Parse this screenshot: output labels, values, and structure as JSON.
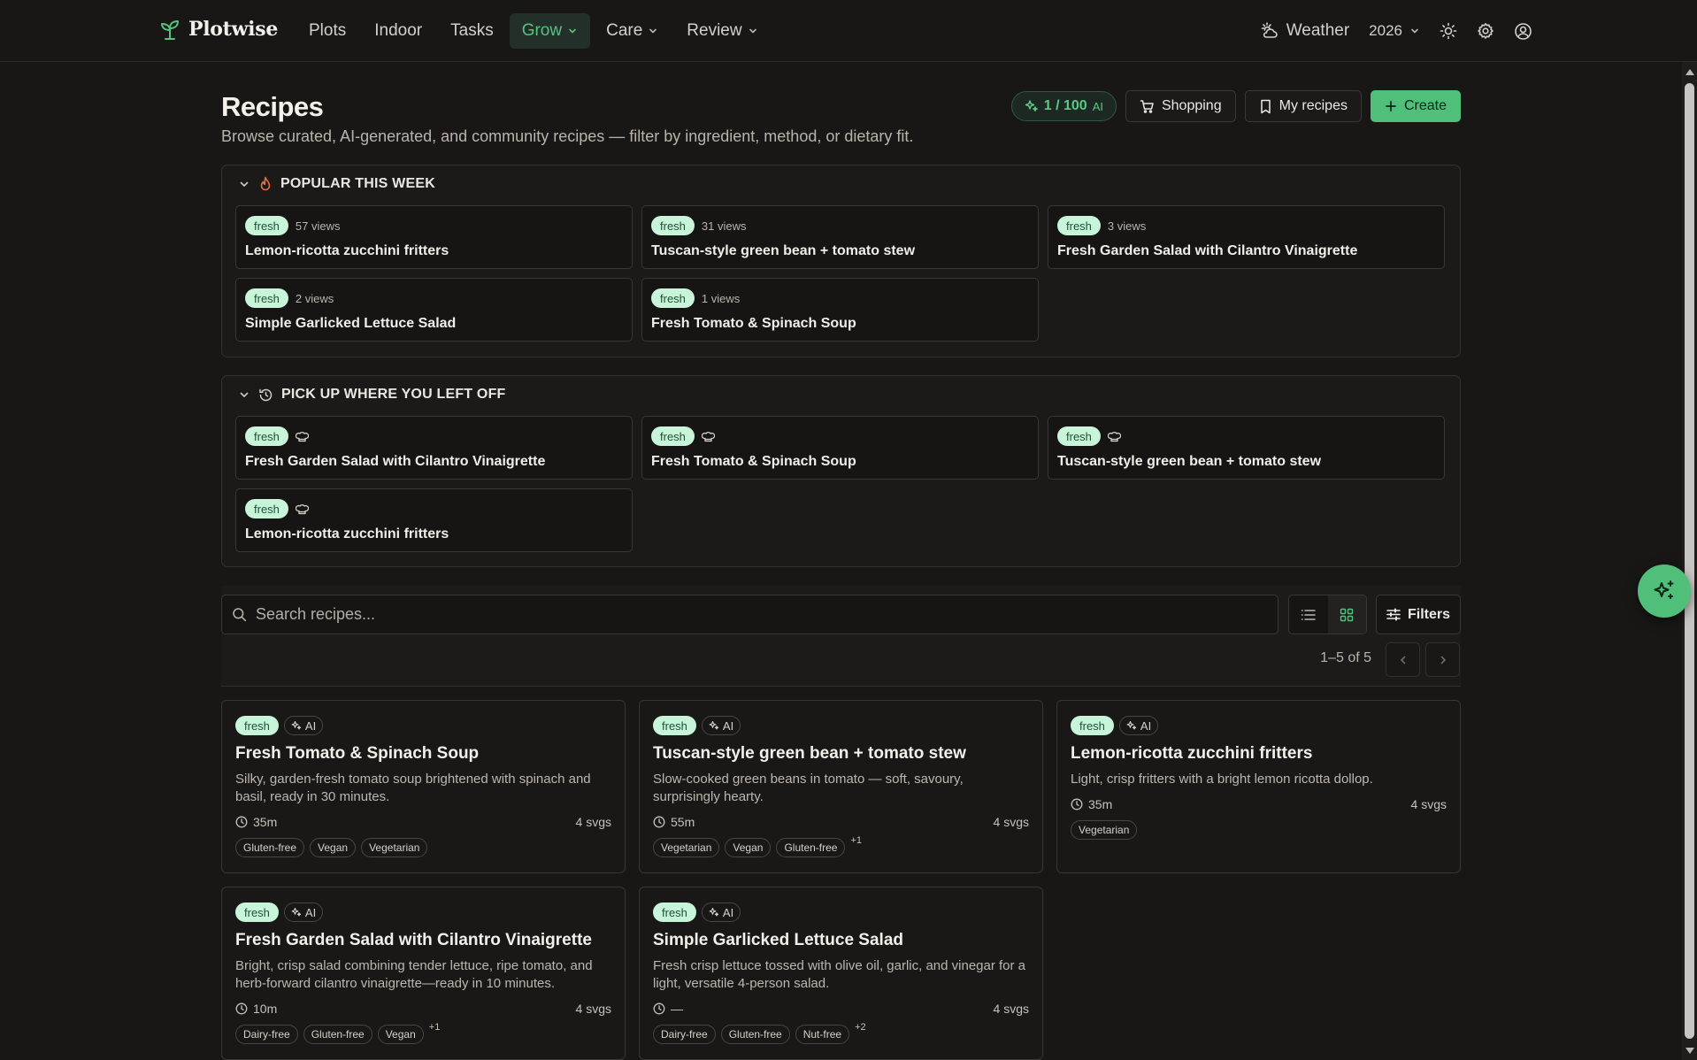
{
  "nav": {
    "brand": "Plotwise",
    "links": [
      {
        "label": "Plots"
      },
      {
        "label": "Indoor"
      },
      {
        "label": "Tasks"
      },
      {
        "label": "Grow"
      },
      {
        "label": "Care"
      },
      {
        "label": "Review"
      }
    ],
    "weather": "Weather",
    "year": "2026"
  },
  "header": {
    "title": "Recipes",
    "subtitle": "Browse curated, AI-generated, and community recipes — filter by ingredient, method, or dietary fit.",
    "ai_quota": "1 / 100",
    "ai_suffix": "AI",
    "shopping": "Shopping",
    "my_recipes": "My recipes",
    "create": "Create"
  },
  "popular": {
    "title": "POPULAR THIS WEEK",
    "items": [
      {
        "badge": "fresh",
        "views": "57 views",
        "title": "Lemon-ricotta zucchini fritters"
      },
      {
        "badge": "fresh",
        "views": "31 views",
        "title": "Tuscan-style green bean + tomato stew"
      },
      {
        "badge": "fresh",
        "views": "3 views",
        "title": "Fresh Garden Salad with Cilantro Vinaigrette"
      },
      {
        "badge": "fresh",
        "views": "2 views",
        "title": "Simple Garlicked Lettuce Salad"
      },
      {
        "badge": "fresh",
        "views": "1 views",
        "title": "Fresh Tomato & Spinach Soup"
      }
    ]
  },
  "recent": {
    "title": "PICK UP WHERE YOU LEFT OFF",
    "items": [
      {
        "badge": "fresh",
        "title": "Fresh Garden Salad with Cilantro Vinaigrette"
      },
      {
        "badge": "fresh",
        "title": "Fresh Tomato & Spinach Soup"
      },
      {
        "badge": "fresh",
        "title": "Tuscan-style green bean + tomato stew"
      },
      {
        "badge": "fresh",
        "title": "Lemon-ricotta zucchini fritters"
      }
    ]
  },
  "toolbar": {
    "search_placeholder": "Search recipes...",
    "filters": "Filters",
    "range": "1–5 of 5"
  },
  "recipes": [
    {
      "badge": "fresh",
      "ai": "AI",
      "title": "Fresh Tomato & Spinach Soup",
      "desc": "Silky, garden-fresh tomato soup brightened with spinach and basil, ready in 30 minutes.",
      "time": "35m",
      "svgs": "4 svgs",
      "tags": [
        "Gluten-free",
        "Vegan",
        "Vegetarian"
      ],
      "more": ""
    },
    {
      "badge": "fresh",
      "ai": "AI",
      "title": "Tuscan-style green bean + tomato stew",
      "desc": "Slow-cooked green beans in tomato — soft, savoury, surprisingly hearty.",
      "time": "55m",
      "svgs": "4 svgs",
      "tags": [
        "Vegetarian",
        "Vegan",
        "Gluten-free"
      ],
      "more": "+1"
    },
    {
      "badge": "fresh",
      "ai": "AI",
      "title": "Lemon-ricotta zucchini fritters",
      "desc": "Light, crisp fritters with a bright lemon ricotta dollop.",
      "time": "35m",
      "svgs": "4 svgs",
      "tags": [
        "Vegetarian"
      ],
      "more": ""
    },
    {
      "badge": "fresh",
      "ai": "AI",
      "title": "Fresh Garden Salad with Cilantro Vinaigrette",
      "desc": "Bright, crisp salad combining tender lettuce, ripe tomato, and herb-forward cilantro vinaigrette—ready in 10 minutes.",
      "time": "10m",
      "svgs": "4 svgs",
      "tags": [
        "Dairy-free",
        "Gluten-free",
        "Vegan"
      ],
      "more": "+1"
    },
    {
      "badge": "fresh",
      "ai": "AI",
      "title": "Simple Garlicked Lettuce Salad",
      "desc": "Fresh crisp lettuce tossed with olive oil, garlic, and vinegar for a light, versatile 4-person salad.",
      "time": "—",
      "svgs": "4 svgs",
      "tags": [
        "Dairy-free",
        "Gluten-free",
        "Nut-free"
      ],
      "more": "+2"
    }
  ],
  "colors": {
    "accent": "#4fbf7a",
    "fresh_pill_bg": "#c8f5da",
    "background": "#191716"
  }
}
